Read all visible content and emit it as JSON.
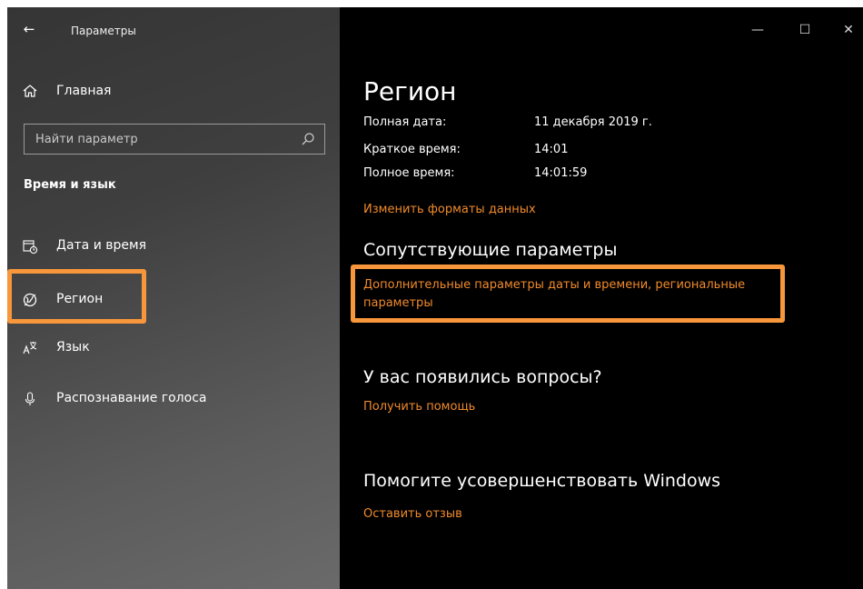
{
  "app": {
    "title": "Параметры"
  },
  "colors": {
    "accent": "#f08a2b",
    "highlight": "#f7963b",
    "pane_bg": "#000000"
  },
  "sidebar": {
    "home_label": "Главная",
    "search": {
      "placeholder": "Найти параметр"
    },
    "section_heading": "Время и язык",
    "items": [
      {
        "label": "Дата и время",
        "icon": "calendar-clock-icon"
      },
      {
        "label": "Регион",
        "icon": "globe-icon"
      },
      {
        "label": "Язык",
        "icon": "language-icon"
      },
      {
        "label": "Распознавание голоса",
        "icon": "microphone-icon"
      }
    ]
  },
  "main": {
    "title": "Регион",
    "rows": [
      {
        "key": "Полная дата:",
        "value": "11 декабря 2019 г."
      },
      {
        "key": "Краткое время:",
        "value": "14:01"
      },
      {
        "key": "Полное время:",
        "value": "14:01:59"
      }
    ],
    "change_formats_link": "Изменить форматы данных",
    "related_heading": "Сопутствующие параметры",
    "advanced_link": "Дополнительные параметры даты и времени, региональные параметры",
    "questions_heading": "У вас появились вопросы?",
    "help_link": "Получить помощь",
    "improve_heading": "Помогите усовершенствовать Windows",
    "feedback_link": "Оставить отзыв"
  },
  "window_controls": {
    "minimize": "—",
    "maximize": "☐",
    "close": "✕"
  },
  "back_glyph": "←"
}
